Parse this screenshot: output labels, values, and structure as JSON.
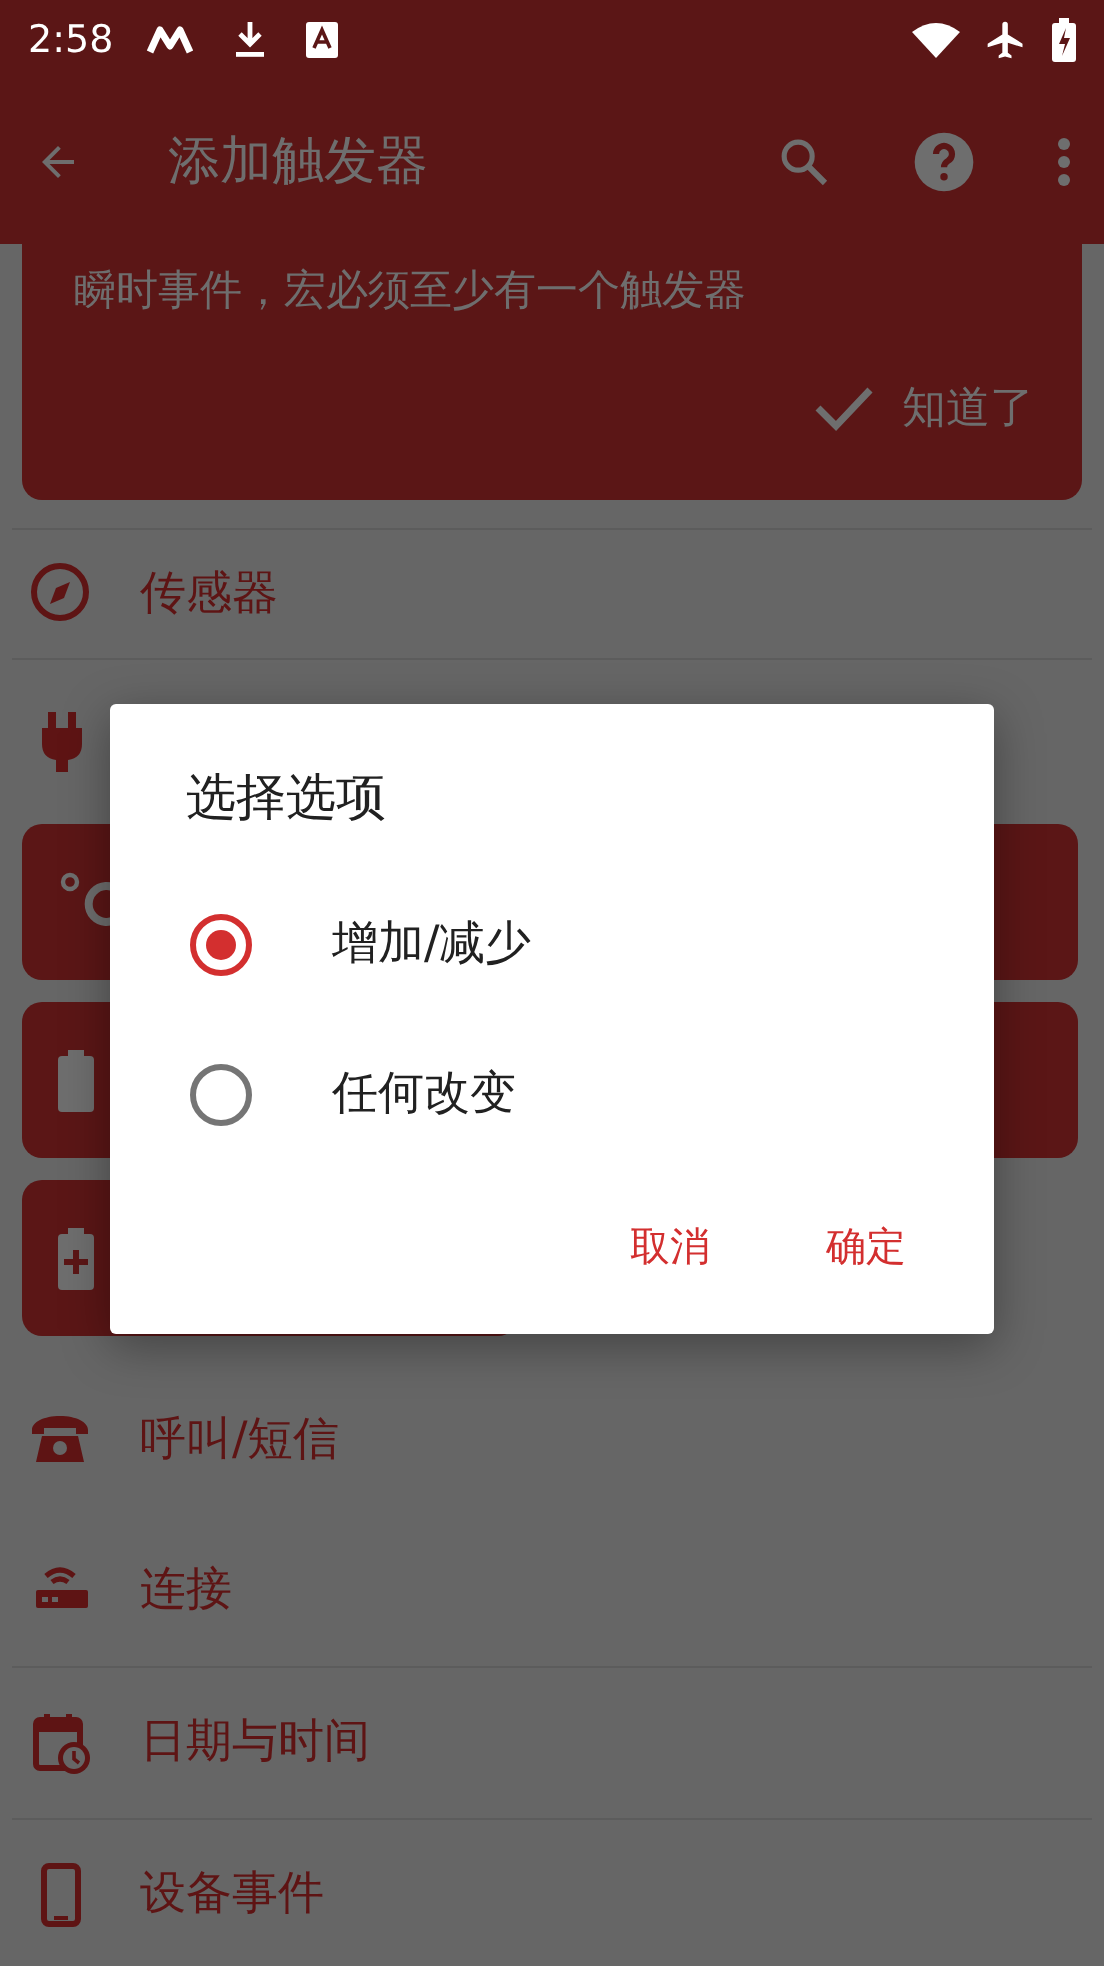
{
  "status_bar": {
    "time": "2:58"
  },
  "app_bar": {
    "title": "添加触发器"
  },
  "info_card": {
    "text": "瞬时事件，宏必须至少有一个触发器",
    "button": "知道了"
  },
  "top_categories": [
    {
      "label": "传感器"
    }
  ],
  "categories": [
    {
      "label": "呼叫/短信"
    },
    {
      "label": "连接"
    },
    {
      "label": "日期与时间"
    },
    {
      "label": "设备事件"
    }
  ],
  "dialog": {
    "title": "选择选项",
    "options": [
      {
        "label": "增加/减少",
        "selected": true
      },
      {
        "label": "任何改变",
        "selected": false
      }
    ],
    "buttons": [
      "取消",
      "确定"
    ]
  }
}
